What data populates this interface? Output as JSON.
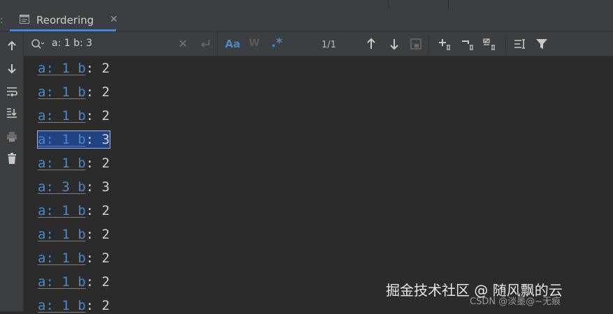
{
  "tab": {
    "label": "Reordering"
  },
  "find": {
    "query": "a: 1 b: 3",
    "match_case_label": "Aa",
    "words_label": "W",
    "regex_label": ".*",
    "match_count": "1/1"
  },
  "console_lines": [
    {
      "link": "a: 1 b",
      "rest": ": 2"
    },
    {
      "link": "a: 1 b",
      "rest": ": 2"
    },
    {
      "link": "a: 1 b",
      "rest": ": 2"
    },
    {
      "link": "a: 1 b",
      "rest": ": 3",
      "highlighted": true
    },
    {
      "link": "a: 1 b",
      "rest": ": 2"
    },
    {
      "link": "a: 3 b",
      "rest": ": 3"
    },
    {
      "link": "a: 1 b",
      "rest": ": 2"
    },
    {
      "link": "a: 1 b",
      "rest": ": 2"
    },
    {
      "link": "a: 1 b",
      "rest": ": 2"
    },
    {
      "link": "a: 1 b",
      "rest": ": 2"
    },
    {
      "link": "a: 1 b",
      "rest": ": 2"
    }
  ],
  "watermark": {
    "main": "掘金技术社区 @ 随风飘的云",
    "sub": "CSDN @淡墨@~无痕"
  },
  "colors": {
    "accent": "#4a88c7",
    "selection": "#214283",
    "background": "#2b2b2b"
  }
}
